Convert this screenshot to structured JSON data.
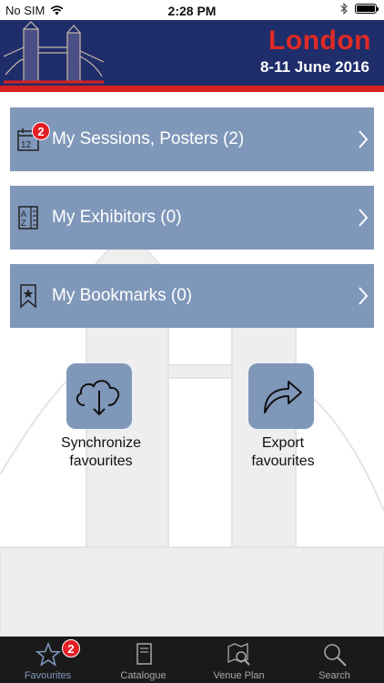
{
  "status_bar": {
    "carrier": "No SIM",
    "time": "2:28 PM"
  },
  "header": {
    "city": "London",
    "dates": "8-11 June 2016"
  },
  "menu": [
    {
      "label": "My Sessions, Posters (2)",
      "icon": "calendar-icon",
      "badge": "2"
    },
    {
      "label": "My Exhibitors (0)",
      "icon": "a-z-directory-icon"
    },
    {
      "label": "My Bookmarks (0)",
      "icon": "bookmark-star-icon"
    }
  ],
  "actions": [
    {
      "label_line1": "Synchronize",
      "label_line2": "favourites",
      "icon": "cloud-download-icon"
    },
    {
      "label_line1": "Export",
      "label_line2": "favourites",
      "icon": "share-arrow-icon"
    }
  ],
  "tabs": [
    {
      "label": "Favourites",
      "icon": "star-icon",
      "badge": "2",
      "active": true
    },
    {
      "label": "Catalogue",
      "icon": "book-icon"
    },
    {
      "label": "Venue Plan",
      "icon": "map-search-icon"
    },
    {
      "label": "Search",
      "icon": "search-icon"
    }
  ],
  "colors": {
    "banner": "#1f2d6b",
    "title_red": "#e02a24",
    "tile": "#7f97b9",
    "badge": "#e31f26",
    "tabbar": "#1a1a1a"
  }
}
